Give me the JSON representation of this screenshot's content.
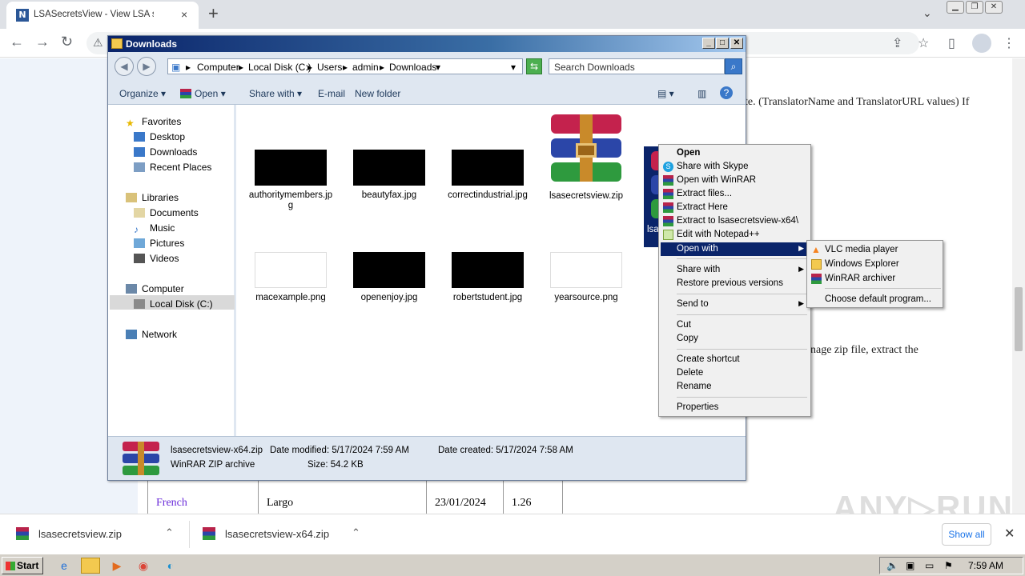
{
  "browser": {
    "tab_title": "LSASecretsView - View LSA secrets s",
    "tab_favicon": "N",
    "new_tab": "+",
    "close_tab": "×",
    "tab_menu": "⌄"
  },
  "page": {
    "line1": "te. (TranslatorName and TranslatorURL values) If",
    "line2": "nage zip file, extract the",
    "table_row": [
      "French",
      "Largo",
      "23/01/2024",
      "1.26"
    ],
    "watermark": "ANY▷RUN"
  },
  "explorer": {
    "title": "Downloads",
    "breadcrumb": [
      "Computer",
      "Local Disk (C:)",
      "Users",
      "admin",
      "Downloads"
    ],
    "search_placeholder": "Search Downloads",
    "commands": [
      "Organize",
      "Open",
      "Share with",
      "E-mail",
      "New folder"
    ],
    "nav": {
      "favorites": "Favorites",
      "desktop": "Desktop",
      "downloads": "Downloads",
      "recent": "Recent Places",
      "libraries": "Libraries",
      "documents": "Documents",
      "music": "Music",
      "pictures": "Pictures",
      "videos": "Videos",
      "computer": "Computer",
      "localdisk": "Local Disk (C:)",
      "network": "Network"
    },
    "files": [
      {
        "name": "authoritymembers.jpg"
      },
      {
        "name": "beautyfax.jpg"
      },
      {
        "name": "correctindustrial.jpg"
      },
      {
        "name": "lsasecretsview.zip"
      },
      {
        "name": "lsa"
      },
      {
        "name": "macexample.png"
      },
      {
        "name": "openenjoy.jpg"
      },
      {
        "name": "robertstudent.jpg"
      },
      {
        "name": "yearsource.png"
      }
    ],
    "status": {
      "filename": "lsasecretsview-x64.zip",
      "modified": "Date modified: 5/17/2024 7:59 AM",
      "created": "Date created: 5/17/2024 7:58 AM",
      "type": "WinRAR ZIP archive",
      "size": "Size: 54.2 KB"
    }
  },
  "context_menu": {
    "items": [
      "Open",
      "Share with Skype",
      "Open with WinRAR",
      "Extract files...",
      "Extract Here",
      "Extract to lsasecretsview-x64\\",
      "Edit with Notepad++",
      "Open with",
      "Share with",
      "Restore previous versions",
      "Send to",
      "Cut",
      "Copy",
      "Create shortcut",
      "Delete",
      "Rename",
      "Properties"
    ]
  },
  "submenu": {
    "items": [
      "VLC media player",
      "Windows Explorer",
      "WinRAR archiver",
      "Choose default program..."
    ]
  },
  "downloads": {
    "items": [
      "lsasecretsview.zip",
      "lsasecretsview-x64.zip"
    ],
    "show_all": "Show all"
  },
  "taskbar": {
    "start": "Start",
    "clock": "7:59 AM"
  }
}
